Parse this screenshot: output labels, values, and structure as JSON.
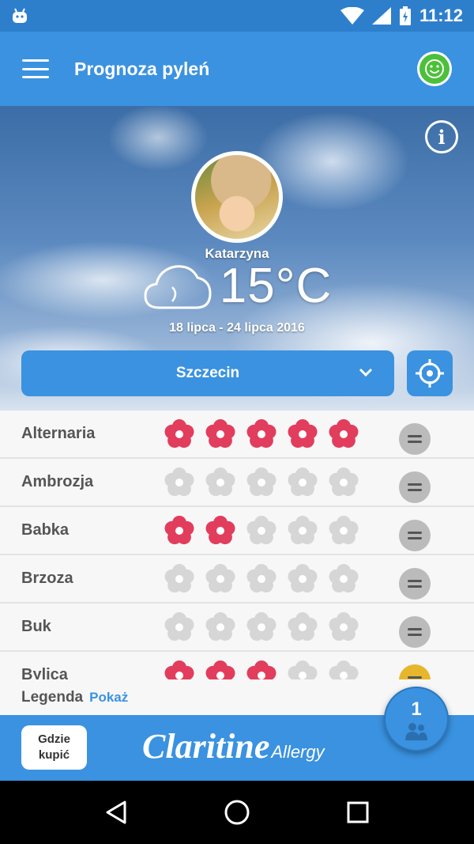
{
  "status_bar": {
    "time": "11:12"
  },
  "app_bar": {
    "title": "Prognoza pyleń"
  },
  "hero": {
    "user_name": "Katarzyna",
    "temperature": "15°C",
    "date_range": "18 lipca - 24 lipca 2016",
    "city": "Szczecin"
  },
  "pollen_list": [
    {
      "name": "Alternaria",
      "level": 5,
      "trend": "steady"
    },
    {
      "name": "Ambrozja",
      "level": 0,
      "trend": "steady"
    },
    {
      "name": "Babka",
      "level": 2,
      "trend": "steady"
    },
    {
      "name": "Brzoza",
      "level": 0,
      "trend": "steady"
    },
    {
      "name": "Buk",
      "level": 0,
      "trend": "steady"
    },
    {
      "name": "Bylica",
      "level": 3,
      "trend": "up"
    }
  ],
  "legend": {
    "label": "Legenda",
    "show_label": "Pokaż"
  },
  "footer": {
    "buy_label_line1": "Gdzie",
    "buy_label_line2": "kupić",
    "brand_main": "Claritine",
    "brand_sub": "Allergy"
  },
  "fab": {
    "count": "1"
  },
  "colors": {
    "primary": "#3a92e0",
    "flower_active": "#e23d5c",
    "flower_inactive": "#d6d6d6",
    "smile": "#4cc03a"
  },
  "icons": [
    "android-icon",
    "wifi-icon",
    "signal-icon",
    "battery-icon",
    "menu-icon",
    "smile-icon",
    "info-icon",
    "cloud-moon-icon",
    "chevron-down-icon",
    "locate-icon",
    "flower-icon",
    "equal-icon",
    "users-icon",
    "back-icon",
    "home-icon",
    "recents-icon"
  ]
}
